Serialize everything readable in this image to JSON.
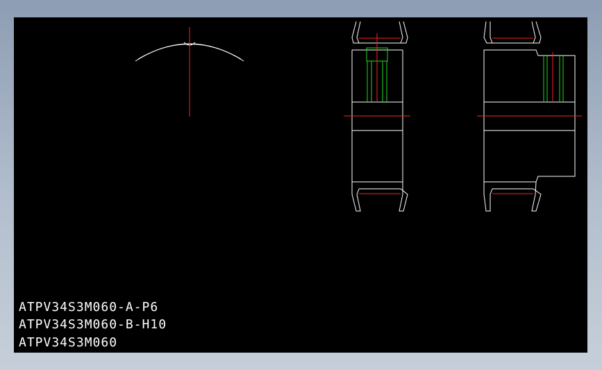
{
  "drawing": {
    "colors": {
      "background": "#000000",
      "outline": "#ffffff",
      "centerline": "#ff2020",
      "hidden_feature": "#22dd22"
    },
    "views": [
      "tooth-profile-detail",
      "section-view-a",
      "section-view-b"
    ]
  },
  "labels": [
    "ATPV34S3M060-A-P6",
    "ATPV34S3M060-B-H10",
    "ATPV34S3M060"
  ]
}
